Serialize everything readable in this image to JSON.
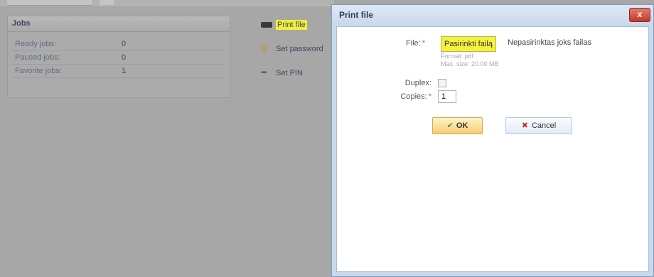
{
  "jobs": {
    "title": "Jobs",
    "rows": [
      {
        "label": "Ready jobs:",
        "value": "0"
      },
      {
        "label": "Paused jobs:",
        "value": "0"
      },
      {
        "label": "Favorite jobs:",
        "value": "1"
      }
    ]
  },
  "actions": [
    {
      "label": "Print file",
      "icon": "printer-icon"
    },
    {
      "label": "Set password",
      "icon": "key-icon"
    },
    {
      "label": "Set PIN",
      "icon": "pin-icon"
    }
  ],
  "dialog": {
    "title": "Print file",
    "close_label": "x",
    "file_label": "File:",
    "required_mark": "*",
    "choose_file_button": "Pasirinkti failą",
    "no_file_text": "Nepasirinktas joks failas",
    "format_hint": "Format: pdf",
    "max_size_hint": "Max. size: 20.00 MB",
    "duplex_label": "Duplex:",
    "duplex_checked": false,
    "copies_label": "Copies:",
    "copies_value": "1",
    "ok_label": "OK",
    "cancel_label": "Cancel"
  },
  "colors": {
    "highlight": "#f5f23c",
    "dialog_border": "#7f9ec4",
    "close_red": "#c3392b",
    "ok_orange": "#f6ce72"
  }
}
